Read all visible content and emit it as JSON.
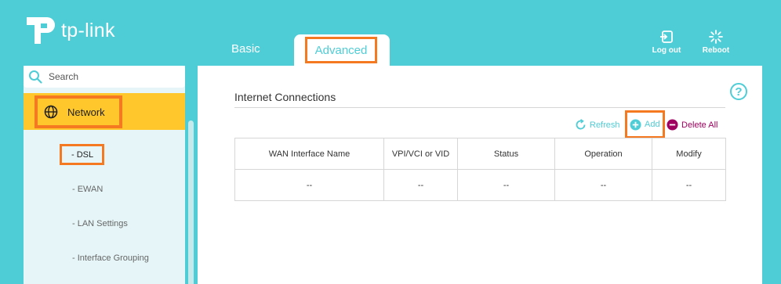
{
  "brand": {
    "name": "tp-link"
  },
  "tabs": [
    {
      "label": "Basic"
    },
    {
      "label": "Advanced",
      "active": true
    }
  ],
  "top_actions": {
    "logout": "Log out",
    "reboot": "Reboot"
  },
  "sidebar": {
    "search_label": "Search",
    "network_label": "Network",
    "items": [
      {
        "label": "- DSL",
        "selected": true
      },
      {
        "label": "- EWAN"
      },
      {
        "label": "- LAN Settings"
      },
      {
        "label": "- Interface Grouping"
      }
    ]
  },
  "section": {
    "title": "Internet Connections",
    "help": "?",
    "actions": {
      "refresh": "Refresh",
      "add": "Add",
      "delete_all": "Delete All"
    }
  },
  "table": {
    "headers": [
      "WAN Interface Name",
      "VPI/VCI or VID",
      "Status",
      "Operation",
      "Modify"
    ],
    "rows": [
      [
        "--",
        "--",
        "--",
        "--",
        "--"
      ]
    ]
  },
  "colors": {
    "brand_teal": "#4ecdd6",
    "highlight_orange": "#f47920",
    "selected_yellow": "#ffc72c",
    "delete_magenta": "#a0005f"
  }
}
